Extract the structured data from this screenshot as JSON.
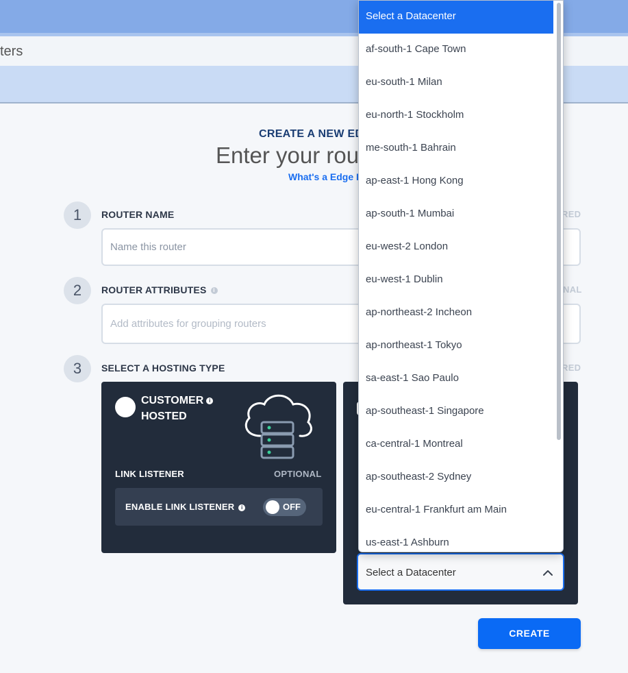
{
  "header": {
    "breadcrumb_fragment": "ters"
  },
  "page": {
    "overline": "CREATE A NEW ED",
    "headline": "Enter your rou",
    "help_link": "What's a Edge I"
  },
  "steps": [
    {
      "number": "1",
      "label": "ROUTER NAME",
      "tag": "RED"
    },
    {
      "number": "2",
      "label": "ROUTER ATTRIBUTES",
      "tag": "NAL"
    },
    {
      "number": "3",
      "label": "SELECT A HOSTING TYPE",
      "tag": "RED"
    }
  ],
  "router_name": {
    "placeholder": "Name this router",
    "value": ""
  },
  "router_attributes": {
    "placeholder": "Add attributes for grouping routers",
    "value": ""
  },
  "customer_hosted": {
    "title_line1": "CUSTOMER",
    "title_line2": "HOSTED",
    "link_listener_label": "LINK LISTENER",
    "link_listener_tag": "OPTIONAL",
    "enable_link_listener_label": "ENABLE LINK LISTENER",
    "toggle_state": "OFF",
    "info_glyph": "i"
  },
  "datacenter_select": {
    "selected_value": "Select a Datacenter",
    "options": [
      "Select a Datacenter",
      "af-south-1 Cape Town",
      "eu-south-1 Milan",
      "eu-north-1 Stockholm",
      "me-south-1 Bahrain",
      "ap-east-1 Hong Kong",
      "ap-south-1 Mumbai",
      "eu-west-2 London",
      "eu-west-1 Dublin",
      "ap-northeast-2 Incheon",
      "ap-northeast-1 Tokyo",
      "sa-east-1 Sao Paulo",
      "ap-southeast-1 Singapore",
      "ca-central-1 Montreal",
      "ap-southeast-2 Sydney",
      "eu-central-1 Frankfurt am Main",
      "us-east-1 Ashburn"
    ]
  },
  "actions": {
    "create_label": "CREATE"
  },
  "colors": {
    "primary": "#1a6ef0",
    "card_bg": "#222c3b",
    "header_bar": "#84aae7"
  }
}
